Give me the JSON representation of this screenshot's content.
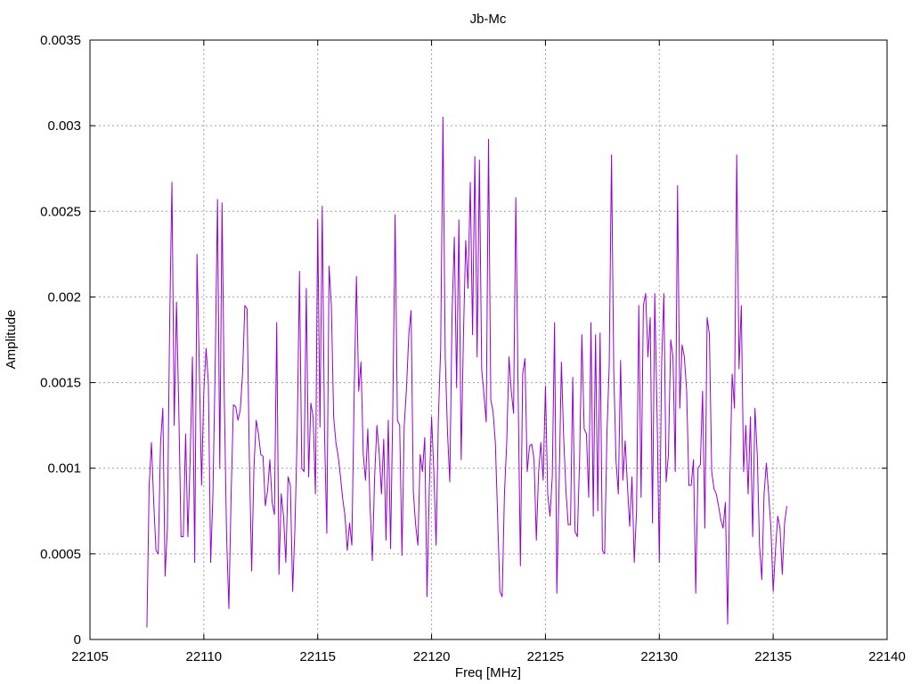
{
  "chart_data": {
    "type": "line",
    "title": "Jb-Mc",
    "xlabel": "Freq [MHz]",
    "ylabel": "Amplitude",
    "xlim": [
      22105,
      22140
    ],
    "ylim": [
      0,
      0.0035
    ],
    "x_ticks": [
      "22105",
      "22110",
      "22115",
      "22120",
      "22125",
      "22130",
      "22135",
      "22140"
    ],
    "y_ticks": [
      "0",
      "0.0005",
      "0.001",
      "0.0015",
      "0.002",
      "0.0025",
      "0.003",
      "0.0035"
    ],
    "grid": true,
    "legend": "none",
    "series": [
      {
        "color": "#9400d3",
        "x_start": 22107.5,
        "x_step": 0.1,
        "values": [
          7e-05,
          0.0009,
          0.00115,
          0.0008,
          0.00052,
          0.0005,
          0.00115,
          0.00135,
          0.00037,
          0.00065,
          0.00185,
          0.00267,
          0.00125,
          0.00197,
          0.00135,
          0.0006,
          0.0006,
          0.0012,
          0.0006,
          0.00105,
          0.00165,
          0.00045,
          0.00225,
          0.0016,
          0.0009,
          0.00145,
          0.0017,
          0.0015,
          0.00045,
          0.00085,
          0.0016,
          0.00257,
          0.001,
          0.00255,
          0.0014,
          0.0006,
          0.00018,
          0.00085,
          0.00137,
          0.00136,
          0.00128,
          0.00134,
          0.00155,
          0.00195,
          0.00193,
          0.00105,
          0.0004,
          0.001,
          0.00128,
          0.0012,
          0.00108,
          0.00107,
          0.00078,
          0.00087,
          0.00105,
          0.0008,
          0.00073,
          0.00185,
          0.00038,
          0.00085,
          0.00072,
          0.00045,
          0.00095,
          0.0009,
          0.00028,
          0.00065,
          0.0012,
          0.00215,
          0.001,
          0.00098,
          0.00205,
          0.00095,
          0.00138,
          0.0013,
          0.00085,
          0.00245,
          0.00124,
          0.00253,
          0.0012,
          0.00062,
          0.00218,
          0.00195,
          0.0013,
          0.00115,
          0.00107,
          0.00095,
          0.00082,
          0.00072,
          0.00052,
          0.00068,
          0.00055,
          0.00142,
          0.00212,
          0.00145,
          0.00162,
          0.00108,
          0.00093,
          0.00123,
          0.00078,
          0.00046,
          0.00095,
          0.00125,
          0.00109,
          0.00085,
          0.00117,
          0.00058,
          0.00128,
          0.00053,
          0.00137,
          0.00248,
          0.00128,
          0.00125,
          0.00049,
          0.00125,
          0.00147,
          0.00178,
          0.00192,
          0.00086,
          0.00067,
          0.00055,
          0.00108,
          0.00098,
          0.00118,
          0.00025,
          0.00088,
          0.0013,
          0.00098,
          0.00055,
          0.0013,
          0.0017,
          0.00305,
          0.00165,
          0.00121,
          0.00092,
          0.0019,
          0.00235,
          0.00147,
          0.00245,
          0.00105,
          0.00178,
          0.00233,
          0.00205,
          0.00267,
          0.00178,
          0.00282,
          0.00165,
          0.0028,
          0.00158,
          0.00143,
          0.00127,
          0.00292,
          0.0014,
          0.00133,
          0.00115,
          0.00072,
          0.00028,
          0.00025,
          0.00085,
          0.00115,
          0.00165,
          0.00145,
          0.00132,
          0.00258,
          0.00145,
          0.00043,
          0.00155,
          0.00164,
          0.00098,
          0.00113,
          0.00114,
          0.00105,
          0.00058,
          0.00098,
          0.00115,
          0.00093,
          0.00148,
          0.00085,
          0.00072,
          0.00095,
          0.00185,
          0.00027,
          0.0009,
          0.00162,
          0.00118,
          0.00087,
          0.00067,
          0.00067,
          0.00153,
          0.00063,
          0.0006,
          0.00105,
          0.00178,
          0.00123,
          0.0012,
          0.00083,
          0.00185,
          0.00072,
          0.00178,
          0.00075,
          0.00179,
          0.00052,
          0.0005,
          0.0012,
          0.0016,
          0.00283,
          0.00157,
          0.00104,
          0.00085,
          0.00163,
          0.00093,
          0.00116,
          0.0009,
          0.00066,
          0.00095,
          0.00045,
          0.00075,
          0.00195,
          0.00083,
          0.00195,
          0.00202,
          0.00165,
          0.00188,
          0.00068,
          0.00202,
          0.00133,
          0.00045,
          0.0016,
          0.00202,
          0.00092,
          0.00108,
          0.00175,
          0.00165,
          0.00098,
          0.00265,
          0.00135,
          0.00172,
          0.00165,
          0.00145,
          0.0009,
          0.0009,
          0.00105,
          0.00027,
          0.001,
          0.00102,
          0.00145,
          0.00065,
          0.00188,
          0.00178,
          0.00098,
          0.00088,
          0.00085,
          0.00078,
          0.0007,
          0.00065,
          0.0008,
          9e-05,
          0.00095,
          0.00155,
          0.00135,
          0.00283,
          0.00158,
          0.00195,
          0.00098,
          0.00125,
          0.00085,
          0.0013,
          0.0006,
          0.00135,
          0.00108,
          0.00055,
          0.00035,
          0.00085,
          0.00103,
          0.00085,
          0.00065,
          0.00028,
          0.00052,
          0.00072,
          0.00065,
          0.00038,
          0.00068,
          0.00078
        ]
      }
    ]
  }
}
